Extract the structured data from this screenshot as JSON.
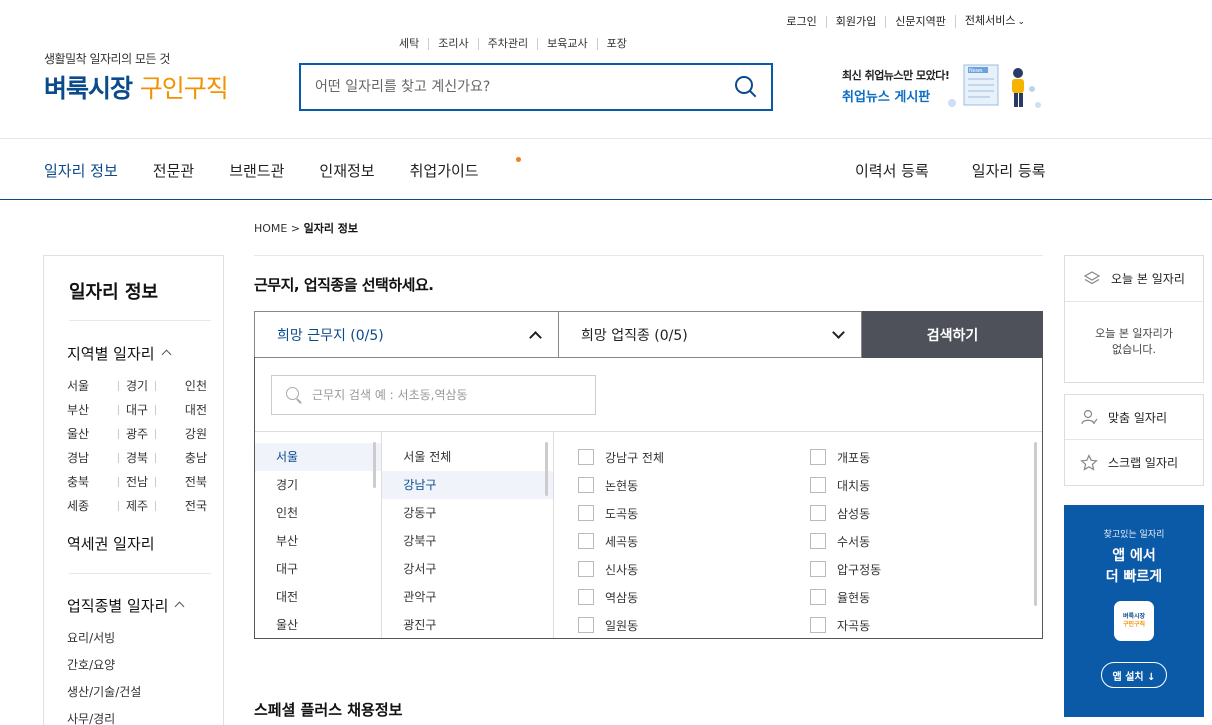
{
  "util": {
    "login": "로그인",
    "signup": "회원가입",
    "newspaper_area": "신문지역판",
    "all_services": "전체서비스"
  },
  "logo": {
    "tagline": "생활밀착 일자리의 모든 것",
    "name_a": "벼룩시장",
    "name_b": "구인구직"
  },
  "keywords": [
    "세탁",
    "조리사",
    "주차관리",
    "보육교사",
    "포장"
  ],
  "search": {
    "placeholder": "어떤 일자리를 찾고 계신가요?"
  },
  "news": {
    "line1": "최신 취업뉴스만 모았다!",
    "line2": "취업뉴스 게시판",
    "badge": "News"
  },
  "gnb": {
    "items": [
      "일자리 정보",
      "전문관",
      "브랜드관",
      "인재정보",
      "취업가이드"
    ],
    "right": [
      "이력서 등록",
      "일자리 등록"
    ]
  },
  "breadcrumb": {
    "home": "HOME",
    "sep": ">",
    "current": "일자리 정보"
  },
  "lnb": {
    "title": "일자리 정보",
    "region_title": "지역별 일자리",
    "regions": [
      [
        "서울",
        "경기",
        "인천"
      ],
      [
        "부산",
        "대구",
        "대전"
      ],
      [
        "울산",
        "광주",
        "강원"
      ],
      [
        "경남",
        "경북",
        "충남"
      ],
      [
        "충북",
        "전남",
        "전북"
      ],
      [
        "세종",
        "제주",
        "전국"
      ]
    ],
    "station": "역세권 일자리",
    "job_title": "업직종별 일자리",
    "jobs": [
      "요리/서빙",
      "간호/요양",
      "생산/기술/건설",
      "사무/경리"
    ]
  },
  "main": {
    "heading": "근무지, 업직종을 선택하세요.",
    "tab_location": "희망 근무지 (0/5)",
    "tab_job": "희망 업직종 (0/5)",
    "search_button": "검색하기",
    "loc_placeholder": "근무지 검색 예 : 서초동,역삼동",
    "cities": [
      "서울",
      "경기",
      "인천",
      "부산",
      "대구",
      "대전",
      "울산"
    ],
    "districts": [
      "서울 전체",
      "강남구",
      "강동구",
      "강북구",
      "강서구",
      "관악구",
      "광진구"
    ],
    "dongs_left": [
      "강남구 전체",
      "논현동",
      "도곡동",
      "세곡동",
      "신사동",
      "역삼동",
      "일원동"
    ],
    "dongs_right": [
      "개포동",
      "대치동",
      "삼성동",
      "수서동",
      "압구정동",
      "율현동",
      "자곡동"
    ],
    "special": "스페셜 플러스 채용정보"
  },
  "right": {
    "recent_title": "오늘 본 일자리",
    "recent_empty_1": "오늘 본 일자리가",
    "recent_empty_2": "없습니다.",
    "match": "맞춤 일자리",
    "scrap": "스크랩 일자리",
    "app_small": "찾고있는 일자리",
    "app_line1": "앱 에서",
    "app_line2": "더 빠르게",
    "app_logo_a": "벼룩시장",
    "app_logo_b": "구인구직",
    "app_install": "앱 설치 ↓"
  },
  "colors": {
    "brand_blue": "#0b4a8d",
    "brand_orange": "#f39200",
    "app_bg": "#0b5aa8",
    "search_btn": "#4e5159"
  }
}
